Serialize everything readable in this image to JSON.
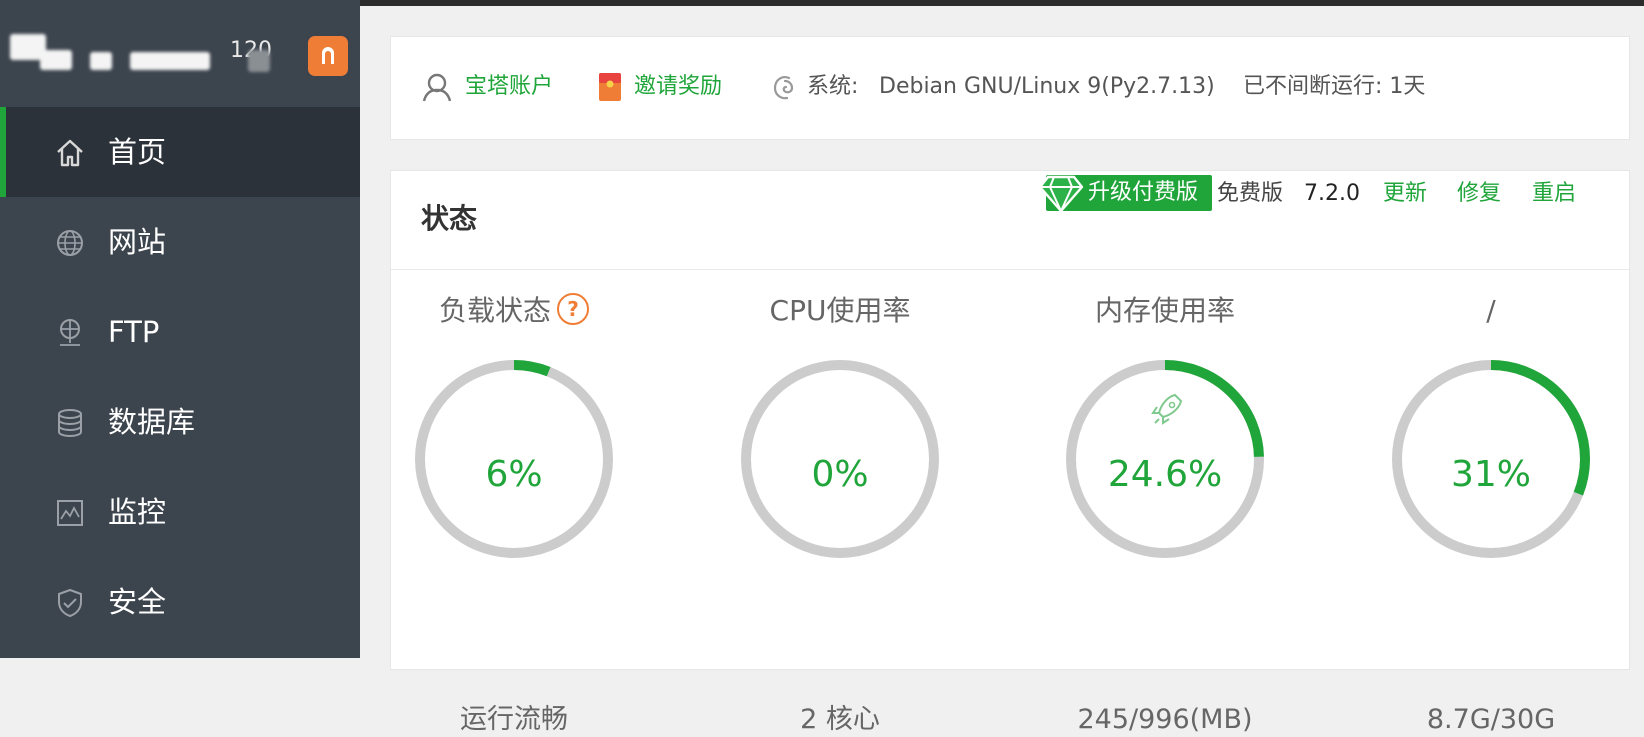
{
  "sidebar": {
    "ip_fragment": "120",
    "items": [
      {
        "label": "首页",
        "icon": "home-icon",
        "active": true
      },
      {
        "label": "网站",
        "icon": "globe-icon",
        "active": false
      },
      {
        "label": "FTP",
        "icon": "ftp-icon",
        "active": false
      },
      {
        "label": "数据库",
        "icon": "database-icon",
        "active": false
      },
      {
        "label": "监控",
        "icon": "monitor-icon",
        "active": false
      },
      {
        "label": "安全",
        "icon": "shield-icon",
        "active": false
      }
    ]
  },
  "infobar": {
    "account": "宝塔账户",
    "invite": "邀请奖励",
    "system_label": "系统:",
    "system_value": "Debian GNU/Linux 9(Py2.7.13)",
    "uptime": "已不间断运行: 1天"
  },
  "status": {
    "title": "状态",
    "upgrade_label": "升级付费版",
    "edition": "免费版",
    "version": "7.2.0",
    "update": "更新",
    "repair": "修复",
    "restart": "重启"
  },
  "gauges": [
    {
      "title": "负载状态",
      "value": "6%",
      "fraction": 0.06,
      "sub": "运行流畅",
      "help": "?"
    },
    {
      "title": "CPU使用率",
      "value": "0%",
      "fraction": 0.0,
      "sub": "2 核心"
    },
    {
      "title": "内存使用率",
      "value": "24.6%",
      "fraction": 0.246,
      "sub": "245/996(MB)"
    },
    {
      "title": "/",
      "value": "31%",
      "fraction": 0.31,
      "sub": "8.7G/30G"
    }
  ],
  "colors": {
    "accent": "#20a53a",
    "sidebar": "#3c444d",
    "badge": "#ef7d36",
    "track": "#cccccc"
  }
}
